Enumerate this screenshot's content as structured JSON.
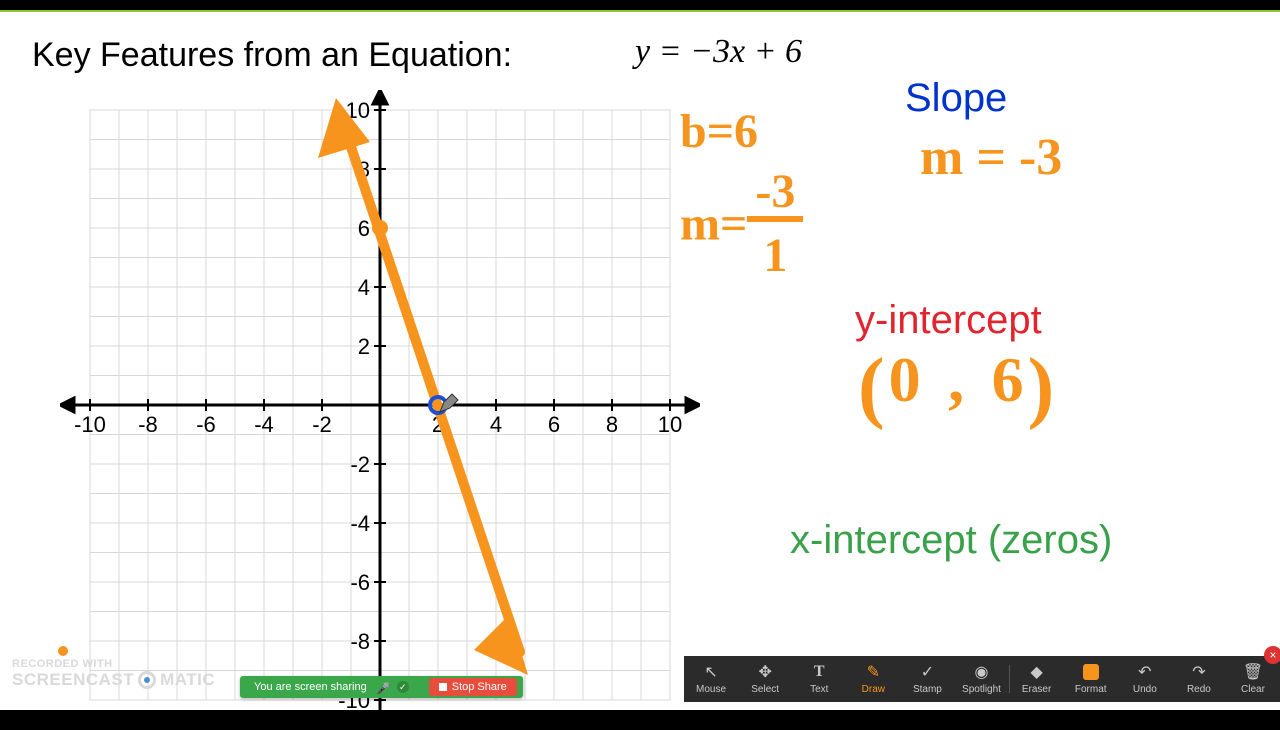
{
  "title": "Key Features from an Equation:",
  "equation_html": "y = −3x + 6",
  "side": {
    "b_eq": "b=6",
    "m_frac_pre": "m=",
    "m_frac_num": "-3",
    "m_frac_den": "1",
    "slope_label": "Slope",
    "m_eq": "m = -3",
    "yint_label": "y-intercept",
    "yint_val_l": "(",
    "yint_val_a": "0",
    "yint_val_c": ",",
    "yint_val_b": "6",
    "yint_val_r": ")",
    "xint_label": "x-intercept (zeros)"
  },
  "chart_data": {
    "type": "line",
    "title": "",
    "xlabel": "",
    "ylabel": "",
    "xlim": [
      -10,
      10
    ],
    "ylim": [
      -10,
      10
    ],
    "xticks": [
      -10,
      -8,
      -6,
      -4,
      -2,
      2,
      4,
      6,
      8,
      10
    ],
    "yticks": [
      -10,
      -8,
      -6,
      -4,
      -2,
      2,
      4,
      6,
      8,
      10
    ],
    "equation": "y = -3x + 6",
    "slope": -3,
    "y_intercept": 6,
    "x_intercept": 2,
    "series": [
      {
        "name": "y=-3x+6",
        "x": [
          -1.33,
          5.33
        ],
        "y": [
          10,
          -10
        ]
      }
    ],
    "points": [
      {
        "x": 0,
        "y": 6,
        "label": "y-intercept"
      },
      {
        "x": 2,
        "y": 0,
        "label": "x-intercept"
      }
    ]
  },
  "watermark": {
    "line1": "RECORDED WITH",
    "line2a": "SCREENCAST",
    "line2b": "MATIC"
  },
  "zoom": {
    "status": "You are screen sharing",
    "stop": "Stop Share"
  },
  "toolbar": {
    "items": [
      {
        "id": "mouse",
        "label": "Mouse"
      },
      {
        "id": "select",
        "label": "Select"
      },
      {
        "id": "text",
        "label": "Text"
      },
      {
        "id": "draw",
        "label": "Draw"
      },
      {
        "id": "stamp",
        "label": "Stamp"
      },
      {
        "id": "spotlight",
        "label": "Spotlight"
      },
      {
        "id": "eraser",
        "label": "Eraser"
      },
      {
        "id": "format",
        "label": "Format"
      },
      {
        "id": "undo",
        "label": "Undo"
      },
      {
        "id": "redo",
        "label": "Redo"
      },
      {
        "id": "clear",
        "label": "Clear"
      }
    ],
    "active": "draw"
  }
}
